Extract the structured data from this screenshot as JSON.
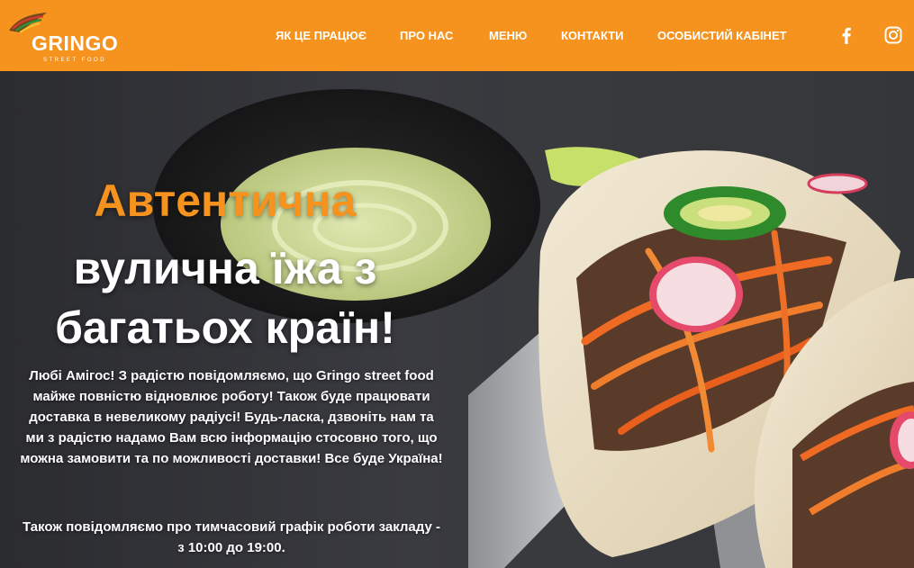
{
  "brand": {
    "name": "GRINGO",
    "tagline": "STREET FOOD"
  },
  "nav": [
    {
      "label": "ЯК ЦЕ ПРАЦЮЄ"
    },
    {
      "label": "ПРО НАС"
    },
    {
      "label": "МЕНЮ"
    },
    {
      "label": "КОНТАКТИ"
    },
    {
      "label": "ОСОБИСТИЙ КАБІНЕТ"
    }
  ],
  "social": [
    {
      "icon": "facebook-icon"
    },
    {
      "icon": "instagram-icon"
    }
  ],
  "hero": {
    "title_line1": "Автентична",
    "title_line2": "вулична їжа з",
    "title_line3": "багатьох країн!",
    "paragraph1": "Любі Амігос! З радістю повідомляємо, що Gringo street food майже повністю відновлює роботу! Також буде працювати доставка в невеликому радіусі! Будь-ласка, дзвоніть нам та ми з радістю надамо Вам всю інформацію стосовно того, що можна замовити та по можливості доставки! Все буде Україна!",
    "paragraph2": "Також повідомляємо про тимчасовий графік роботи закладу - з 10:00 до 19:00."
  },
  "colors": {
    "accent": "#f6921e",
    "text": "#ffffff",
    "background": "#2f2f33"
  }
}
